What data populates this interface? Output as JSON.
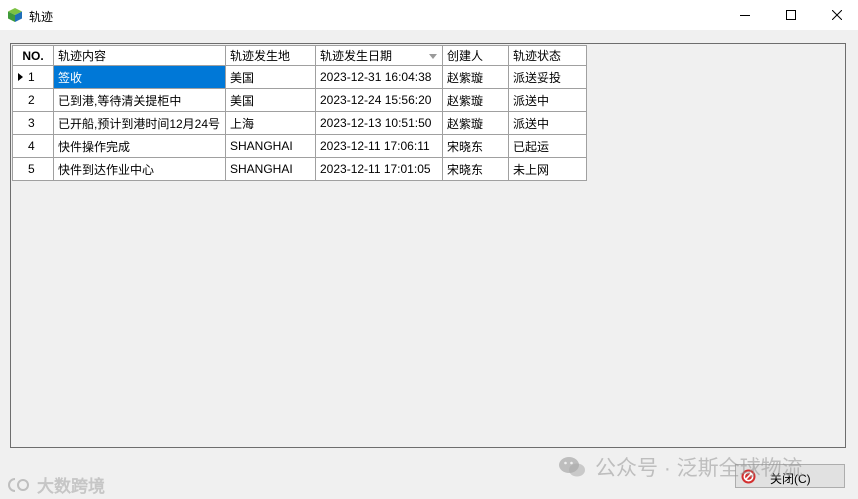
{
  "window": {
    "title": "轨迹",
    "minimize_icon": "minimize-icon",
    "maximize_icon": "maximize-icon",
    "close_icon": "close-icon"
  },
  "grid": {
    "columns": [
      "NO.",
      "轨迹内容",
      "轨迹发生地",
      "轨迹发生日期",
      "创建人",
      "轨迹状态"
    ],
    "sorted_column": "轨迹发生日期",
    "selected_row": 1,
    "rows": [
      {
        "no": "1",
        "content": "签收",
        "location": "美国",
        "date": "2023-12-31 16:04:38",
        "creator": "赵紫璇",
        "status": "派送妥投"
      },
      {
        "no": "2",
        "content": "已到港,等待清关提柜中",
        "location": "美国",
        "date": "2023-12-24 15:56:20",
        "creator": "赵紫璇",
        "status": "派送中"
      },
      {
        "no": "3",
        "content": "已开船,预计到港时间12月24号",
        "location": "上海",
        "date": "2023-12-13 10:51:50",
        "creator": "赵紫璇",
        "status": "派送中"
      },
      {
        "no": "4",
        "content": "快件操作完成",
        "location": "SHANGHAI",
        "date": "2023-12-11 17:06:11",
        "creator": "宋晓东",
        "status": "已起运"
      },
      {
        "no": "5",
        "content": "快件到达作业中心",
        "location": "SHANGHAI",
        "date": "2023-12-11 17:01:05",
        "creator": "宋晓东",
        "status": "未上网"
      }
    ]
  },
  "footer": {
    "close_label": "关闭(C)"
  },
  "watermarks": {
    "left": "大数跨境",
    "right": "公众号 · 泛斯全球物流"
  },
  "colors": {
    "selection": "#0078d7",
    "close_button_icon": "#d32f2f"
  }
}
